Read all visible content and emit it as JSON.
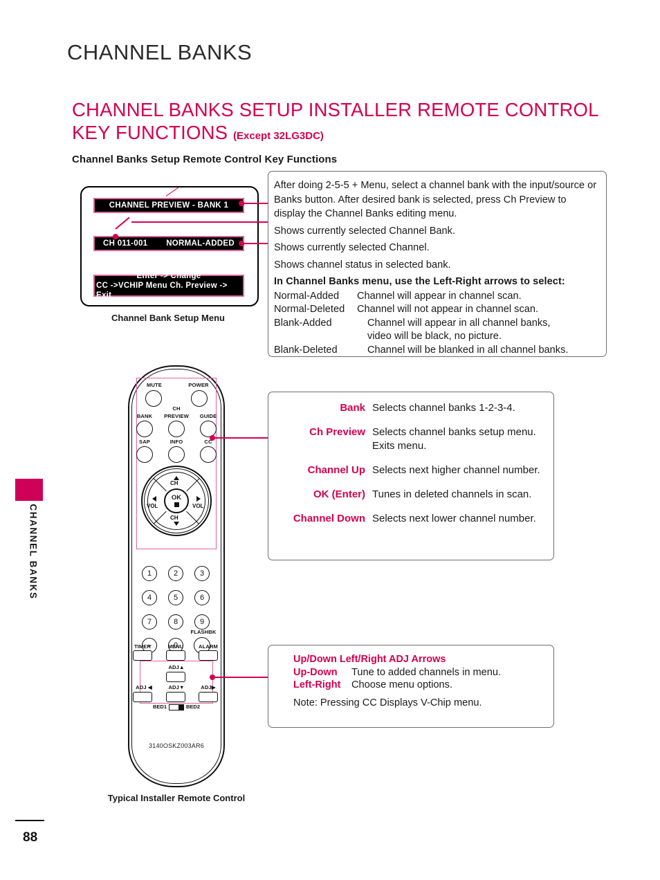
{
  "page": {
    "title": "CHANNEL BANKS",
    "number": "88",
    "sidebar_label": "CHANNEL BANKS"
  },
  "heading": {
    "main": "CHANNEL BANKS SETUP INSTALLER REMOTE CONTROL KEY FUNCTIONS",
    "except": "(Except 32LG3DC)",
    "subheading": "Channel Banks Setup Remote Control Key Functions"
  },
  "menu_diagram": {
    "caption": "Channel Bank Setup Menu",
    "bank_line": "CHANNEL PREVIEW - BANK 1",
    "channel_number": "CH  011-001",
    "channel_status": "NORMAL-ADDED",
    "footer_line1": "Enter -> Change",
    "footer_line2": "CC ->VCHIP Menu  Ch. Preview -> Exit"
  },
  "info_box": {
    "paragraph": "After doing 2-5-5 + Menu, select a channel bank with the input/source or Banks button. After desired bank is selected, press Ch Preview to display the Channel Banks editing menu.",
    "line_bank": "Shows currently selected Channel Bank.",
    "line_channel": "Shows currently selected Channel.",
    "line_status": "Shows channel status in selected bank.",
    "options_lead": "In Channel Banks menu, use the Left-Right arrows to select:",
    "options": [
      {
        "key": "Normal-Added",
        "value": "Channel will appear in channel scan."
      },
      {
        "key": "Normal-Deleted",
        "value": "Channel will not appear in channel scan."
      },
      {
        "key": "Blank-Added",
        "value": "Channel will appear in all channel banks,"
      },
      {
        "key": "",
        "value": "video will be black, no picture."
      },
      {
        "key": "Blank-Deleted",
        "value": "Channel will be blanked in all channel banks."
      }
    ]
  },
  "key_functions": [
    {
      "key": "Bank",
      "value": "Selects channel banks 1-2-3-4."
    },
    {
      "key": "Ch Preview",
      "value": "Selects channel banks setup menu.\nExits menu."
    },
    {
      "key": "Channel Up",
      "value": "Selects next higher channel number."
    },
    {
      "key": "OK (Enter)",
      "value": "Tunes in deleted channels in scan."
    },
    {
      "key": "Channel Down",
      "value": "Selects next lower channel number."
    }
  ],
  "adj_box": {
    "title": "Up/Down Left/Right ADJ Arrows",
    "rows": [
      {
        "key": "Up-Down",
        "value": "Tune to added channels in menu."
      },
      {
        "key": "Left-Right",
        "value": "Choose menu options."
      }
    ],
    "note": "Note: Pressing CC Displays V-Chip menu."
  },
  "remote": {
    "caption": "Typical Installer Remote Control",
    "model": "3140OSKZ003AR6",
    "labels": {
      "mute": "MUTE",
      "power": "POWER",
      "bank": "BANK",
      "ch": "CH",
      "preview": "PREVIEW",
      "guide": "GUIDE",
      "sap": "SAP",
      "info": "INFO",
      "cc": "CC",
      "ok": "OK",
      "ch_up": "CH",
      "ch_down": "CH",
      "vol_left": "VOL",
      "vol_right": "VOL",
      "timer": "TIMER",
      "menu": "MENU",
      "alarm": "ALARM",
      "flashbk": "FLASHBK",
      "adj_up": "ADJ",
      "adj_down": "ADJ",
      "adj_left": "ADJ",
      "adj_right": "ADJ",
      "bed1": "BED1",
      "bed2": "BED2"
    },
    "numbers": [
      "1",
      "2",
      "3",
      "4",
      "5",
      "6",
      "7",
      "8",
      "9",
      "–",
      "0"
    ]
  },
  "colors": {
    "accent": "#D4004F",
    "tab": "#CE0058",
    "highlight": "#E0629A"
  }
}
